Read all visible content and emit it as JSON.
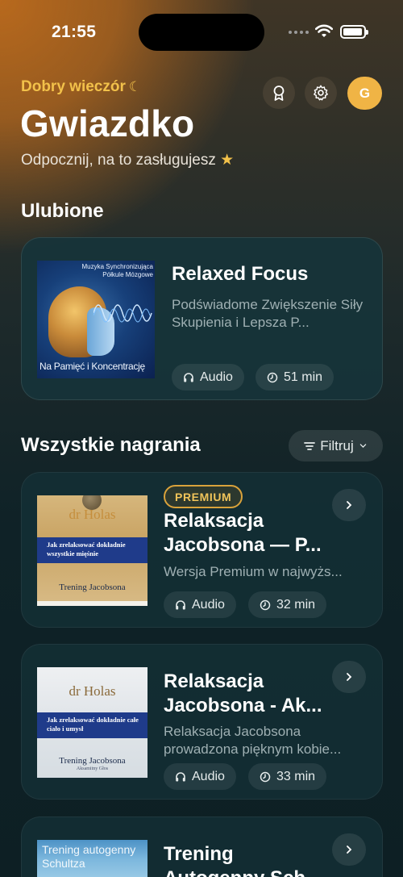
{
  "status": {
    "time": "21:55"
  },
  "header": {
    "greeting": "Dobry wieczór",
    "name": "Gwiazdko",
    "subtitle": "Odpocznij, na to zasługujesz",
    "avatar_initial": "G"
  },
  "favorites": {
    "section_title": "Ulubione",
    "item": {
      "title": "Relaxed Focus",
      "description": "Podświadome Zwiększenie Siły Skupienia i Lepsza P...",
      "type": "Audio",
      "duration": "51 min",
      "cover_top": "Muzyka Synchronizująca Półkule Mózgowe",
      "cover_bottom": "Na Pamięć i Koncentrację"
    }
  },
  "all": {
    "section_title": "Wszystkie nagrania",
    "filter_label": "Filtruj",
    "items": [
      {
        "badge": "PREMIUM",
        "title": "Relaksacja Jacobsona — P...",
        "description": "Wersja Premium w najwyżs...",
        "type": "Audio",
        "duration": "32 min",
        "cover_author": "dr Holas",
        "cover_band": "Jak zrelaksować dokładnie wszystkie mięśnie",
        "cover_title": "Trening Jacobsona"
      },
      {
        "title": "Relaksacja Jacobsona - Ak...",
        "description": "Relaksacja Jacobsona prowadzona pięknym kobie...",
        "type": "Audio",
        "duration": "33 min",
        "cover_author": "dr Holas",
        "cover_band": "Jak zrelaksować dokładnie całe ciało i umysł",
        "cover_title": "Trening Jacobsona",
        "cover_voice": "Aksamitny Głos"
      },
      {
        "title": "Trening Autogenny Sch...",
        "cover_title": "Trening autogenny Schultza"
      }
    ]
  },
  "colors": {
    "accent": "#f2c14a",
    "avatar": "#f0b445",
    "card": "#143036"
  }
}
